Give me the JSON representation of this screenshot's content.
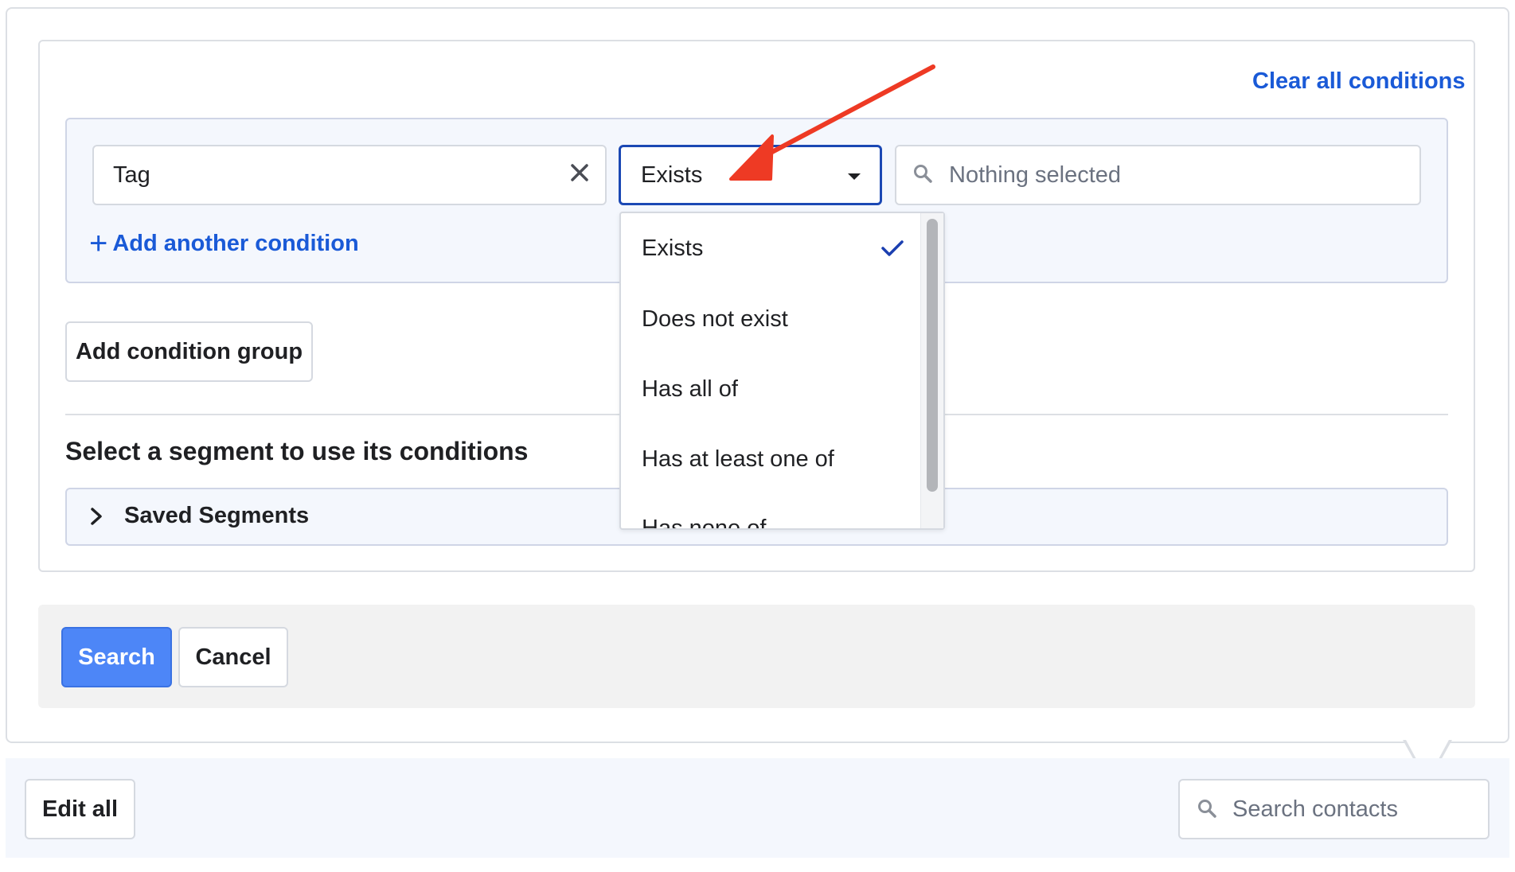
{
  "builder": {
    "clear_all_label": "Clear all conditions",
    "condition": {
      "field_value": "Tag",
      "operator_value": "Exists",
      "value_placeholder": "Nothing selected"
    },
    "add_condition_label": "Add another condition",
    "add_group_label": "Add condition group",
    "segment_heading": "Select a segment to use its conditions",
    "saved_segments_label": "Saved Segments"
  },
  "operator_menu": {
    "options": [
      "Exists",
      "Does not exist",
      "Has all of",
      "Has at least one of",
      "Has none of"
    ],
    "selected": "Exists"
  },
  "actions": {
    "search_label": "Search",
    "cancel_label": "Cancel"
  },
  "toolbar": {
    "edit_all_label": "Edit all",
    "search_placeholder": "Search contacts"
  },
  "colors": {
    "accent": "#1a5ad7",
    "primary_button": "#4d86f7",
    "annotation_arrow": "#ee3a24"
  },
  "icons": [
    "close-icon",
    "caret-down-icon",
    "search-icon",
    "plus-icon",
    "chevron-right-icon",
    "checkmark-icon"
  ]
}
